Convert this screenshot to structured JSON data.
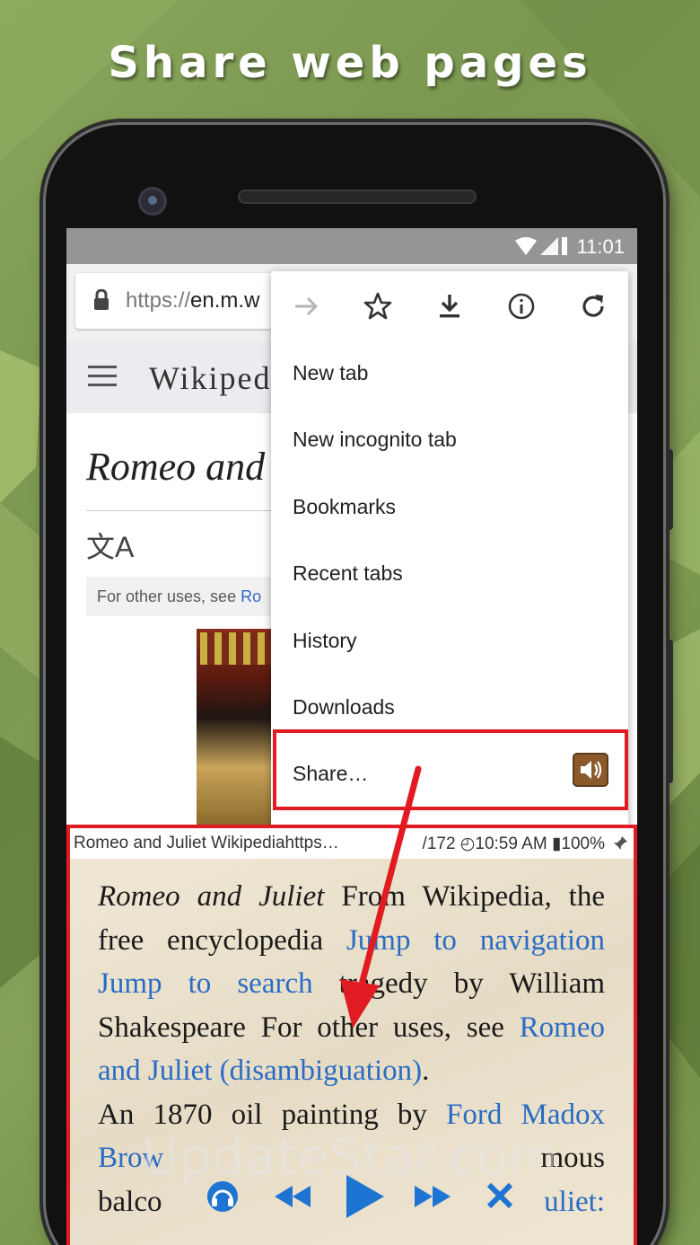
{
  "headline": "Share web pages",
  "status_bar": {
    "time": "11:01"
  },
  "browser": {
    "url_prefix": "https://",
    "url_host": "en.m.w",
    "wiki_wordmark": "Wikiped",
    "article_title": "Romeo and",
    "lang_icon": "文A",
    "hatnote_prefix": "For other uses, see ",
    "hatnote_link": "Ro"
  },
  "menu": {
    "items": [
      "New tab",
      "New incognito tab",
      "Bookmarks",
      "Recent tabs",
      "History",
      "Downloads",
      "Share…"
    ]
  },
  "reader": {
    "status_left": "Romeo and Juliet Wikipediahttps…",
    "status_right": "/172 ◴10:59 AM ▮100%",
    "lines": [
      {
        "t": "Romeo and Juliet",
        "style": "italic"
      },
      {
        "t": " From Wikipedia, the free encyclopedia ",
        "style": "normal"
      },
      {
        "t": "Jump to navigation Jump to search",
        "style": "link"
      },
      {
        "t": " tragedy by William Shakespeare For other uses, see ",
        "style": "normal"
      },
      {
        "t": "Romeo and Juliet (disambiguation)",
        "style": "link"
      },
      {
        "t": ".",
        "style": "normal"
      }
    ],
    "line2_prefix": "An 1870 oil painting by ",
    "line2_link": "Ford Madox Brow",
    "line2_suffix": "mous",
    "line3_start": "balco",
    "line3_end": "uliet:"
  },
  "watermark": "UpdateStar.com",
  "colors": {
    "highlight_red": "#e11b22",
    "link_blue": "#2a6cc4",
    "player_blue": "#1e74d2",
    "background_green": "#7f9a52"
  },
  "icons": {
    "toolbar": [
      "forward-arrow-icon",
      "star-icon",
      "download-icon",
      "info-icon",
      "refresh-icon"
    ],
    "player": [
      "headphones-icon",
      "rewind-icon",
      "play-icon",
      "fast-forward-icon",
      "close-icon"
    ]
  }
}
